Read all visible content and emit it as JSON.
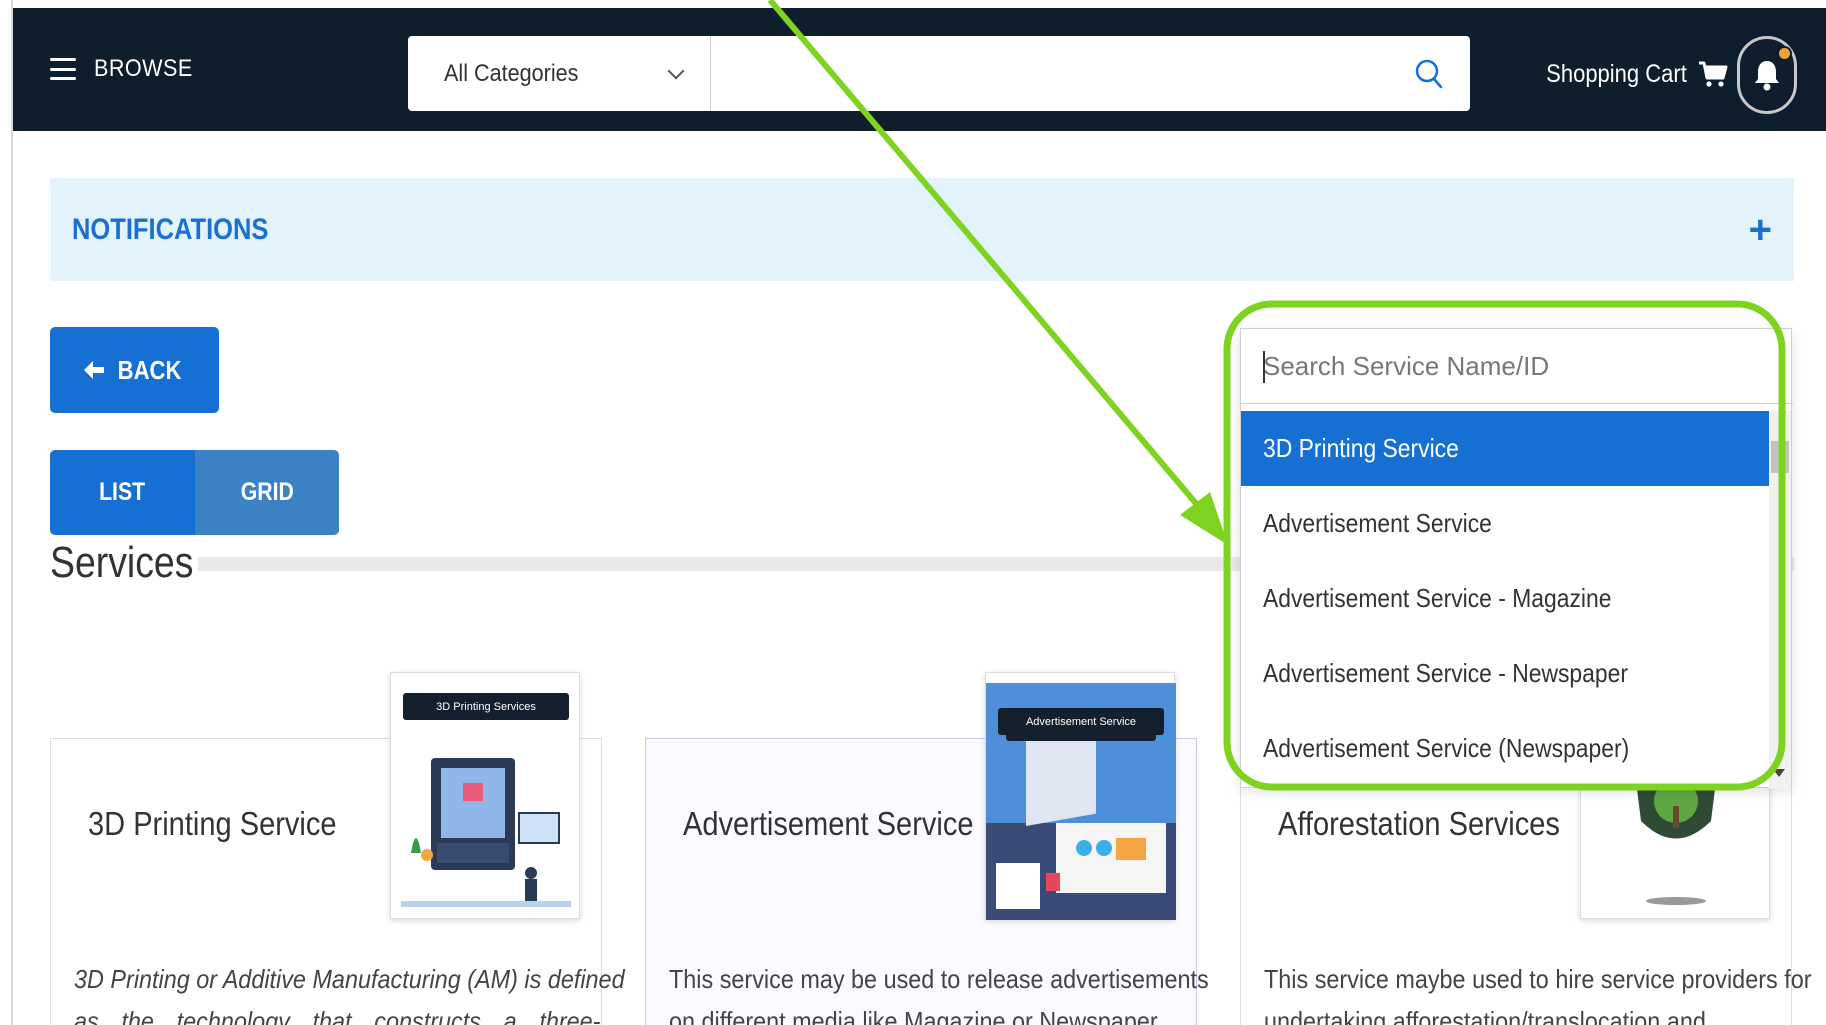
{
  "header": {
    "browse_label": "BROWSE",
    "category_select": "All Categories",
    "search_placeholder": "",
    "cart_label": "Shopping Cart"
  },
  "notifications": {
    "title": "NOTIFICATIONS",
    "expand_symbol": "+"
  },
  "actions": {
    "back_label": "BACK",
    "view_list": "LIST",
    "view_grid": "GRID",
    "active_view": "LIST"
  },
  "services": {
    "title": "Services",
    "cards": [
      {
        "title": "3D Printing Service",
        "thumb_badge": "3D Printing Services",
        "desc_line1": "3D Printing or Additive Manufacturing (AM) is defined",
        "desc_line2": "as the technology that constructs a three-"
      },
      {
        "title": "Advertisement Service",
        "thumb_badge": "Advertisement Service",
        "desc_line1": "This service may be used to release advertisements",
        "desc_line2": "on different media like Magazine or Newspaper"
      },
      {
        "title": "Afforestation Services",
        "thumb_badge": "",
        "desc_line1": "This service maybe used to hire service providers for",
        "desc_line2": "undertaking afforestation/translocation and"
      }
    ]
  },
  "service_dropdown": {
    "search_placeholder": "Search Service Name/ID",
    "selected": "3D Printing Service",
    "options": [
      "3D Printing Service",
      "Advertisement Service",
      "Advertisement Service - Magazine",
      "Advertisement Service - Newspaper",
      "Advertisement Service (Newspaper)"
    ]
  },
  "colors": {
    "header_bg": "#0e1e2c",
    "primary": "#1670d4",
    "notif_bg": "#e2f3fb",
    "annotation": "#7ed321",
    "bell_dot": "#f5a03a"
  }
}
